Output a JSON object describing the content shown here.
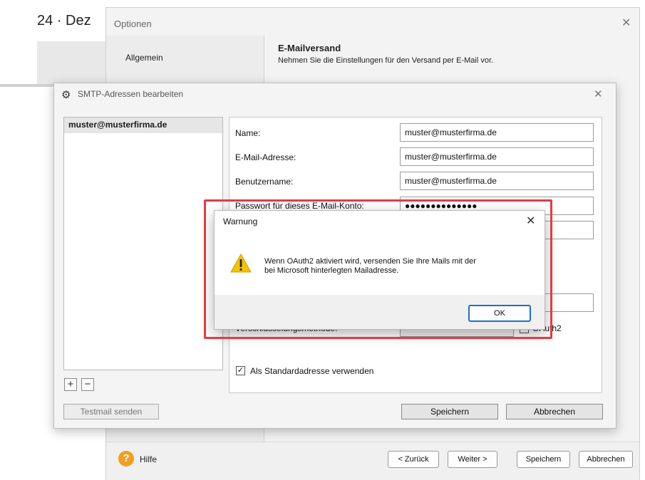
{
  "background": {
    "title_fragment": "24 · Dez"
  },
  "options": {
    "title": "Optionen",
    "sidebar_item": "Allgemein",
    "section_title": "E-Mailversand",
    "section_subtitle": "Nehmen Sie die Einstellungen für den Versand per E-Mail vor.",
    "footer": {
      "help_label": "Hilfe",
      "back_label": "< Zurück",
      "next_label": "Weiter >",
      "save_label": "Speichern",
      "cancel_label": "Abbrechen"
    }
  },
  "smtp_dialog": {
    "title": "SMTP-Adressen bearbeiten",
    "addresses": [
      "muster@musterfirma.de"
    ],
    "fields": {
      "name_label": "Name:",
      "name_value": "muster@musterfirma.de",
      "email_label": "E-Mail-Adresse:",
      "email_value": "muster@musterfirma.de",
      "user_label": "Benutzername:",
      "user_value": "muster@musterfirma.de",
      "password_label": "Passwort für dieses E-Mail-Konto:",
      "password_value": "●●●●●●●●●●●●●●",
      "encryption_label": "Verschlüsselungsmethode:",
      "oauth_label": "OAuth2",
      "default_label": "Als Standardadresse verwenden"
    },
    "default_checked": true,
    "oauth_checked": false,
    "testmail_label": "Testmail senden",
    "save_label": "Speichern",
    "cancel_label": "Abbrechen"
  },
  "warning": {
    "title": "Warnung",
    "message_line1": "Wenn OAuth2 aktiviert wird, versenden Sie Ihre Mails mit der",
    "message_line2": "bei Microsoft hinterlegten Mailadresse.",
    "ok_label": "OK"
  },
  "colors": {
    "highlight": "#e53a45",
    "warning_icon": "#f6c400",
    "ok_border": "#1f6ecc",
    "help_icon": "#f0a020"
  }
}
